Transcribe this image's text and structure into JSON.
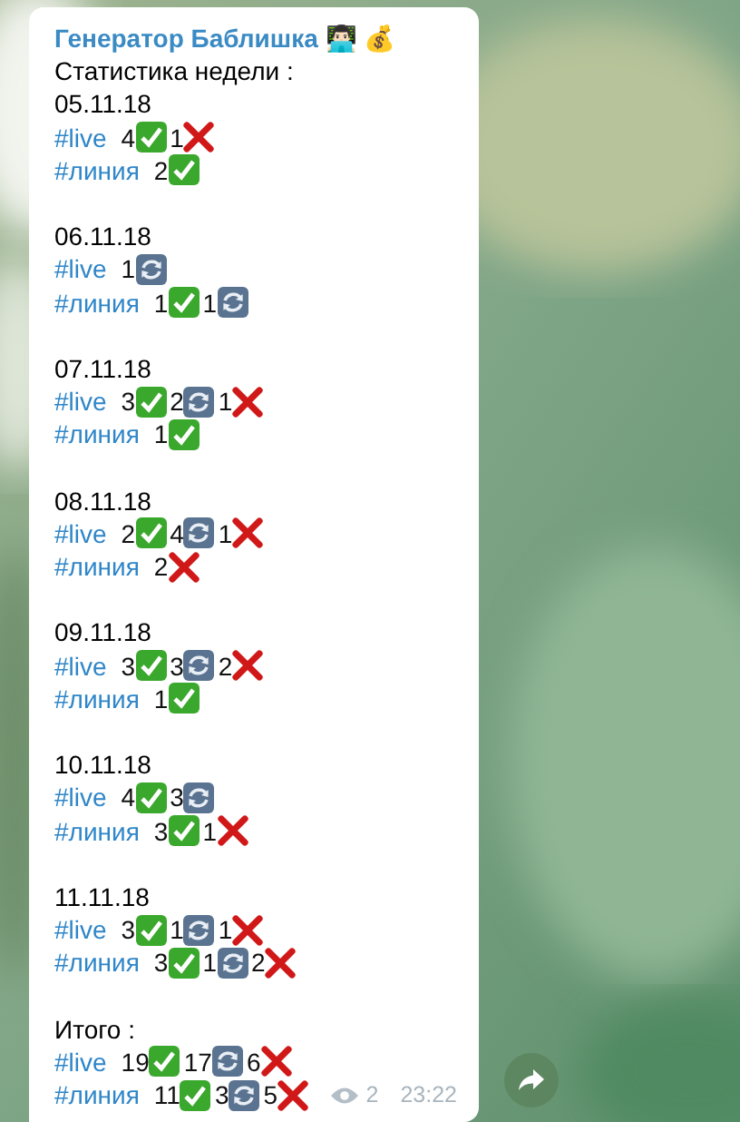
{
  "message": {
    "sender": "Генератор Баблишка",
    "sender_emoji": "👨🏻‍💻 💰",
    "intro": "Статистика недели :",
    "blocks": [
      {
        "heading": "05.11.18",
        "rows": [
          {
            "tag": "#live",
            "items": [
              {
                "count": "4",
                "kind": "win"
              },
              {
                "count": "1",
                "kind": "loss"
              }
            ]
          },
          {
            "tag": "#линия",
            "items": [
              {
                "count": "2",
                "kind": "win"
              }
            ]
          }
        ]
      },
      {
        "heading": "06.11.18",
        "rows": [
          {
            "tag": "#live",
            "items": [
              {
                "count": "1",
                "kind": "refund"
              }
            ]
          },
          {
            "tag": "#линия",
            "items": [
              {
                "count": "1",
                "kind": "win"
              },
              {
                "count": "1",
                "kind": "refund"
              }
            ]
          }
        ]
      },
      {
        "heading": "07.11.18",
        "rows": [
          {
            "tag": "#live",
            "items": [
              {
                "count": "3",
                "kind": "win"
              },
              {
                "count": "2",
                "kind": "refund"
              },
              {
                "count": "1",
                "kind": "loss"
              }
            ]
          },
          {
            "tag": "#линия",
            "items": [
              {
                "count": "1",
                "kind": "win"
              }
            ]
          }
        ]
      },
      {
        "heading": "08.11.18",
        "rows": [
          {
            "tag": "#live",
            "items": [
              {
                "count": "2",
                "kind": "win"
              },
              {
                "count": "4",
                "kind": "refund"
              },
              {
                "count": "1",
                "kind": "loss"
              }
            ]
          },
          {
            "tag": "#линия",
            "items": [
              {
                "count": "2",
                "kind": "loss"
              }
            ]
          }
        ]
      },
      {
        "heading": "09.11.18",
        "rows": [
          {
            "tag": "#live",
            "items": [
              {
                "count": "3",
                "kind": "win"
              },
              {
                "count": "3",
                "kind": "refund"
              },
              {
                "count": "2",
                "kind": "loss"
              }
            ]
          },
          {
            "tag": "#линия",
            "items": [
              {
                "count": "1",
                "kind": "win"
              }
            ]
          }
        ]
      },
      {
        "heading": "10.11.18",
        "rows": [
          {
            "tag": "#live",
            "items": [
              {
                "count": "4",
                "kind": "win"
              },
              {
                "count": "3",
                "kind": "refund"
              }
            ]
          },
          {
            "tag": "#линия",
            "items": [
              {
                "count": "3",
                "kind": "win"
              },
              {
                "count": "1",
                "kind": "loss"
              }
            ]
          }
        ]
      },
      {
        "heading": "11.11.18",
        "rows": [
          {
            "tag": "#live",
            "items": [
              {
                "count": "3",
                "kind": "win"
              },
              {
                "count": "1",
                "kind": "refund"
              },
              {
                "count": "1",
                "kind": "loss"
              }
            ]
          },
          {
            "tag": "#линия",
            "items": [
              {
                "count": "3",
                "kind": "win"
              },
              {
                "count": "1",
                "kind": "refund"
              },
              {
                "count": "2",
                "kind": "loss"
              }
            ]
          }
        ]
      },
      {
        "heading": "Итого :",
        "rows": [
          {
            "tag": "#live",
            "items": [
              {
                "count": "19",
                "kind": "win"
              },
              {
                "count": "17",
                "kind": "refund"
              },
              {
                "count": "6",
                "kind": "loss"
              }
            ]
          },
          {
            "tag": "#линия",
            "items": [
              {
                "count": "11",
                "kind": "win"
              },
              {
                "count": "3",
                "kind": "refund"
              },
              {
                "count": "5",
                "kind": "loss"
              }
            ]
          }
        ]
      }
    ],
    "views": "2",
    "time": "23:22"
  }
}
